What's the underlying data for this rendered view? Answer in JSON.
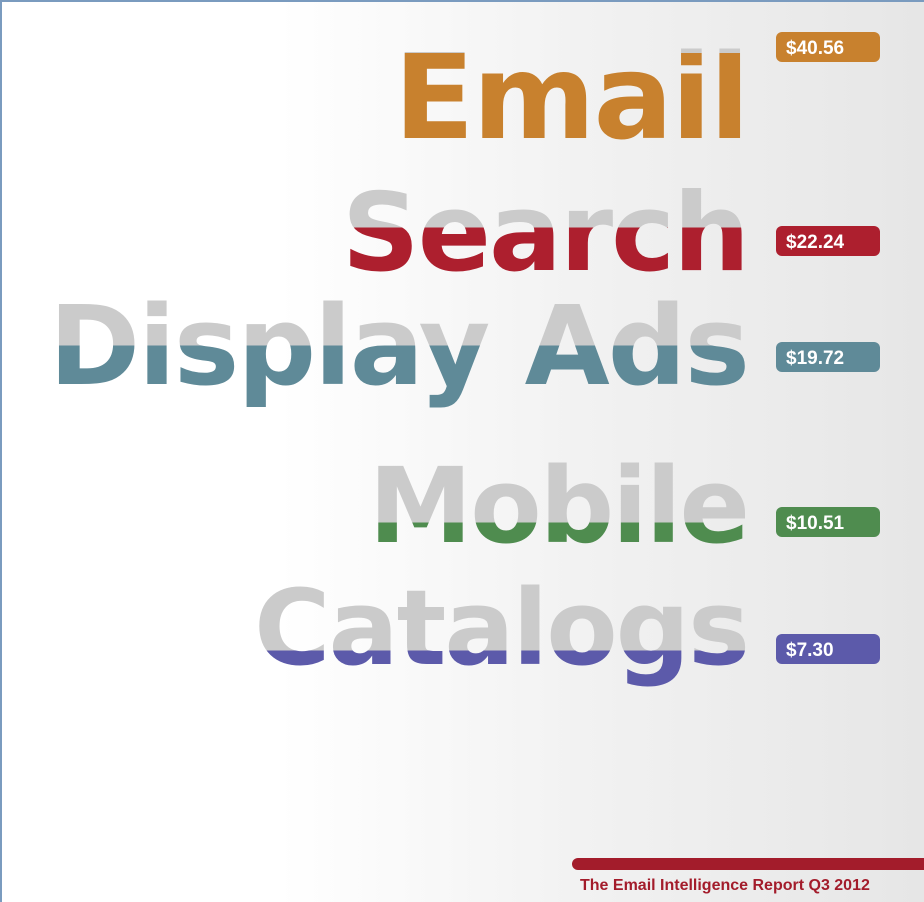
{
  "chart_data": {
    "type": "bar",
    "categories": [
      "Email",
      "Search",
      "Display Ads",
      "Mobile",
      "Catalogs"
    ],
    "values": [
      40.56,
      22.24,
      19.72,
      10.51,
      7.3
    ],
    "value_labels": [
      "$40.56",
      "$22.24",
      "$19.72",
      "$10.51",
      "$7.30"
    ],
    "xlim": [
      0,
      40.56
    ],
    "colors": [
      "#c8812e",
      "#ad1f2e",
      "#5f8a98",
      "#4f8c4f",
      "#5c5aaa"
    ],
    "empty_color": "#cbcbcb"
  },
  "footer": {
    "text": "The Email Intelligence Report Q3 2012",
    "color": "#a31c2b"
  }
}
